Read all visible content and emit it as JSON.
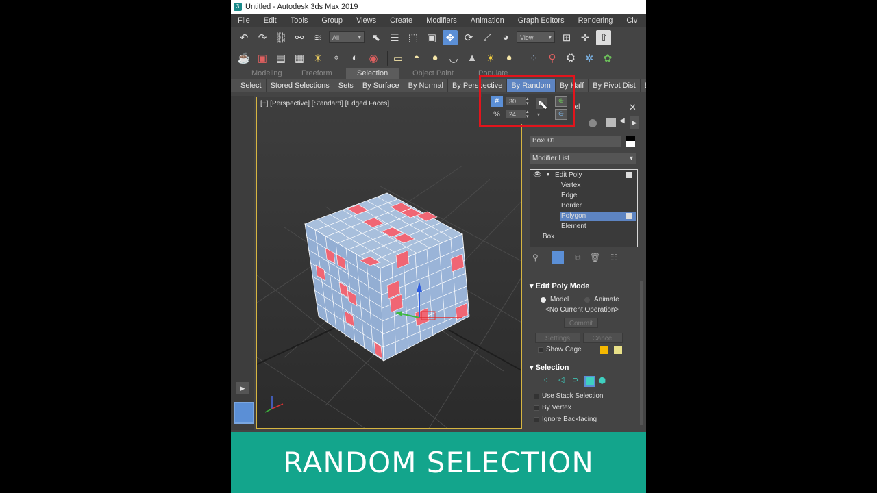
{
  "window": {
    "title": "Untitled - Autodesk 3ds Max 2019"
  },
  "menu": [
    "File",
    "Edit",
    "Tools",
    "Group",
    "Views",
    "Create",
    "Modifiers",
    "Animation",
    "Graph Editors",
    "Rendering",
    "Civ"
  ],
  "toolbar": {
    "filter_value": "All",
    "coord_value": "View"
  },
  "ribbon_tabs": [
    "Modeling",
    "Freeform",
    "Selection",
    "Object Paint",
    "Populate"
  ],
  "ribbon_selected": "Selection",
  "selection_bar": [
    "Select",
    "Stored Selections",
    "Sets",
    "By Surface",
    "By Normal",
    "By Perspective",
    "By Random",
    "By Half",
    "By Pivot Dist",
    "By View"
  ],
  "random_popup": {
    "count_value": "30",
    "percent_value": "24"
  },
  "viewport": {
    "label": "[+] [Perspective] [Standard] [Edged Faces]"
  },
  "command_panel": {
    "title_fragment": "nel",
    "object_name": "Box001",
    "modifier_list": "Modifier List",
    "stack": {
      "modifier": "Edit Poly",
      "subobjects": [
        "Vertex",
        "Edge",
        "Border",
        "Polygon",
        "Element"
      ],
      "selected": "Polygon",
      "base": "Box"
    },
    "edit_poly_mode": {
      "title": "Edit Poly Mode",
      "model": "Model",
      "animate": "Animate",
      "operation": "<No Current Operation>",
      "commit": "Commit",
      "settings": "Settings",
      "cancel": "Cancel",
      "show_cage": "Show Cage"
    },
    "selection": {
      "title": "Selection",
      "use_stack": "Use Stack Selection",
      "by_vertex": "By Vertex",
      "ignore_backfacing": "Ignore Backfacing"
    }
  },
  "banner": {
    "text": "RANDOM SELECTION"
  },
  "colors": {
    "accent": "#5b8fd6",
    "banner": "#13a58c",
    "highlight": "#e2141c",
    "face_red": "#f06674",
    "face_blue": "#9cb4d6"
  }
}
